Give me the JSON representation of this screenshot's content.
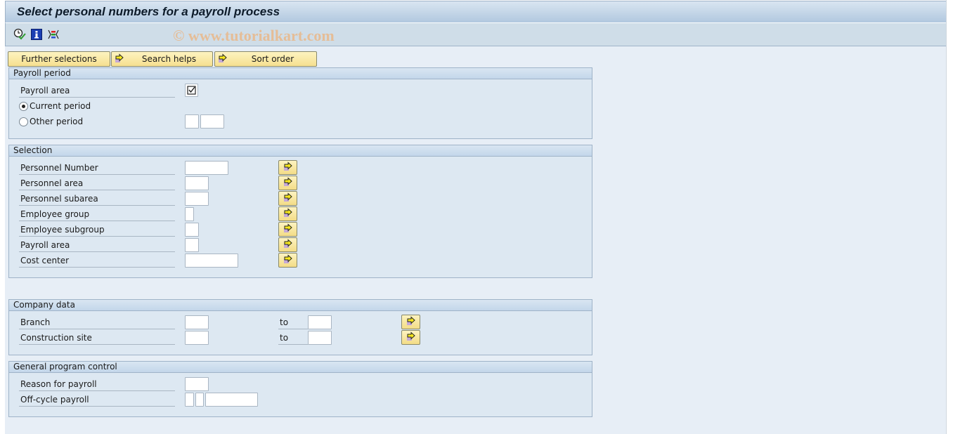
{
  "window": {
    "title": "Select personal numbers for a payroll process",
    "watermark": "© www.tutorialkart.com"
  },
  "toolbar": {
    "icons": [
      "execute-clock-icon",
      "info-icon",
      "selection-options-icon"
    ]
  },
  "buttons": {
    "further_selections": "Further selections",
    "search_helps": "Search helps",
    "sort_order": "Sort order"
  },
  "groups": {
    "payroll_period": {
      "title": "Payroll period",
      "payroll_area_label": "Payroll area",
      "payroll_area_checked": true,
      "current_period_label": "Current period",
      "other_period_label": "Other period",
      "selected_radio": "current_period",
      "other_period_value_1": "",
      "other_period_value_2": ""
    },
    "selection": {
      "title": "Selection",
      "rows": [
        {
          "label": "Personnel Number",
          "value": ""
        },
        {
          "label": "Personnel area",
          "value": ""
        },
        {
          "label": "Personnel subarea",
          "value": ""
        },
        {
          "label": "Employee group",
          "value": ""
        },
        {
          "label": "Employee subgroup",
          "value": ""
        },
        {
          "label": "Payroll area",
          "value": ""
        },
        {
          "label": "Cost center",
          "value": ""
        }
      ]
    },
    "company_data": {
      "title": "Company data",
      "to_label": "to",
      "rows": [
        {
          "label": "Branch",
          "from": "",
          "to": ""
        },
        {
          "label": "Construction site",
          "from": "",
          "to": ""
        }
      ]
    },
    "general_program_control": {
      "title": "General program control",
      "reason_label": "Reason for payroll",
      "reason_value": "",
      "offcycle_label": "Off-cycle payroll",
      "offcycle_values": [
        "",
        "",
        ""
      ]
    }
  },
  "colors": {
    "background": "#e7eef6",
    "group_bg": "#dde8f2",
    "button_yellow": "#f6e08f",
    "title_bar": "#b1c8df"
  }
}
